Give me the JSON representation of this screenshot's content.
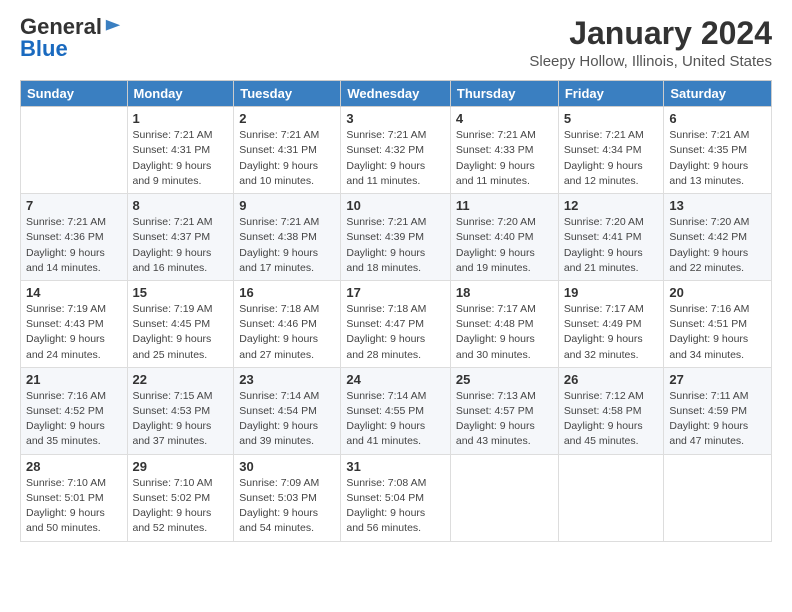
{
  "logo": {
    "general": "General",
    "blue": "Blue"
  },
  "header": {
    "title": "January 2024",
    "location": "Sleepy Hollow, Illinois, United States"
  },
  "days_of_week": [
    "Sunday",
    "Monday",
    "Tuesday",
    "Wednesday",
    "Thursday",
    "Friday",
    "Saturday"
  ],
  "weeks": [
    [
      {
        "day": "",
        "info": ""
      },
      {
        "day": "1",
        "info": "Sunrise: 7:21 AM\nSunset: 4:31 PM\nDaylight: 9 hours\nand 9 minutes."
      },
      {
        "day": "2",
        "info": "Sunrise: 7:21 AM\nSunset: 4:31 PM\nDaylight: 9 hours\nand 10 minutes."
      },
      {
        "day": "3",
        "info": "Sunrise: 7:21 AM\nSunset: 4:32 PM\nDaylight: 9 hours\nand 11 minutes."
      },
      {
        "day": "4",
        "info": "Sunrise: 7:21 AM\nSunset: 4:33 PM\nDaylight: 9 hours\nand 11 minutes."
      },
      {
        "day": "5",
        "info": "Sunrise: 7:21 AM\nSunset: 4:34 PM\nDaylight: 9 hours\nand 12 minutes."
      },
      {
        "day": "6",
        "info": "Sunrise: 7:21 AM\nSunset: 4:35 PM\nDaylight: 9 hours\nand 13 minutes."
      }
    ],
    [
      {
        "day": "7",
        "info": "Sunrise: 7:21 AM\nSunset: 4:36 PM\nDaylight: 9 hours\nand 14 minutes."
      },
      {
        "day": "8",
        "info": "Sunrise: 7:21 AM\nSunset: 4:37 PM\nDaylight: 9 hours\nand 16 minutes."
      },
      {
        "day": "9",
        "info": "Sunrise: 7:21 AM\nSunset: 4:38 PM\nDaylight: 9 hours\nand 17 minutes."
      },
      {
        "day": "10",
        "info": "Sunrise: 7:21 AM\nSunset: 4:39 PM\nDaylight: 9 hours\nand 18 minutes."
      },
      {
        "day": "11",
        "info": "Sunrise: 7:20 AM\nSunset: 4:40 PM\nDaylight: 9 hours\nand 19 minutes."
      },
      {
        "day": "12",
        "info": "Sunrise: 7:20 AM\nSunset: 4:41 PM\nDaylight: 9 hours\nand 21 minutes."
      },
      {
        "day": "13",
        "info": "Sunrise: 7:20 AM\nSunset: 4:42 PM\nDaylight: 9 hours\nand 22 minutes."
      }
    ],
    [
      {
        "day": "14",
        "info": "Sunrise: 7:19 AM\nSunset: 4:43 PM\nDaylight: 9 hours\nand 24 minutes."
      },
      {
        "day": "15",
        "info": "Sunrise: 7:19 AM\nSunset: 4:45 PM\nDaylight: 9 hours\nand 25 minutes."
      },
      {
        "day": "16",
        "info": "Sunrise: 7:18 AM\nSunset: 4:46 PM\nDaylight: 9 hours\nand 27 minutes."
      },
      {
        "day": "17",
        "info": "Sunrise: 7:18 AM\nSunset: 4:47 PM\nDaylight: 9 hours\nand 28 minutes."
      },
      {
        "day": "18",
        "info": "Sunrise: 7:17 AM\nSunset: 4:48 PM\nDaylight: 9 hours\nand 30 minutes."
      },
      {
        "day": "19",
        "info": "Sunrise: 7:17 AM\nSunset: 4:49 PM\nDaylight: 9 hours\nand 32 minutes."
      },
      {
        "day": "20",
        "info": "Sunrise: 7:16 AM\nSunset: 4:51 PM\nDaylight: 9 hours\nand 34 minutes."
      }
    ],
    [
      {
        "day": "21",
        "info": "Sunrise: 7:16 AM\nSunset: 4:52 PM\nDaylight: 9 hours\nand 35 minutes."
      },
      {
        "day": "22",
        "info": "Sunrise: 7:15 AM\nSunset: 4:53 PM\nDaylight: 9 hours\nand 37 minutes."
      },
      {
        "day": "23",
        "info": "Sunrise: 7:14 AM\nSunset: 4:54 PM\nDaylight: 9 hours\nand 39 minutes."
      },
      {
        "day": "24",
        "info": "Sunrise: 7:14 AM\nSunset: 4:55 PM\nDaylight: 9 hours\nand 41 minutes."
      },
      {
        "day": "25",
        "info": "Sunrise: 7:13 AM\nSunset: 4:57 PM\nDaylight: 9 hours\nand 43 minutes."
      },
      {
        "day": "26",
        "info": "Sunrise: 7:12 AM\nSunset: 4:58 PM\nDaylight: 9 hours\nand 45 minutes."
      },
      {
        "day": "27",
        "info": "Sunrise: 7:11 AM\nSunset: 4:59 PM\nDaylight: 9 hours\nand 47 minutes."
      }
    ],
    [
      {
        "day": "28",
        "info": "Sunrise: 7:10 AM\nSunset: 5:01 PM\nDaylight: 9 hours\nand 50 minutes."
      },
      {
        "day": "29",
        "info": "Sunrise: 7:10 AM\nSunset: 5:02 PM\nDaylight: 9 hours\nand 52 minutes."
      },
      {
        "day": "30",
        "info": "Sunrise: 7:09 AM\nSunset: 5:03 PM\nDaylight: 9 hours\nand 54 minutes."
      },
      {
        "day": "31",
        "info": "Sunrise: 7:08 AM\nSunset: 5:04 PM\nDaylight: 9 hours\nand 56 minutes."
      },
      {
        "day": "",
        "info": ""
      },
      {
        "day": "",
        "info": ""
      },
      {
        "day": "",
        "info": ""
      }
    ]
  ]
}
